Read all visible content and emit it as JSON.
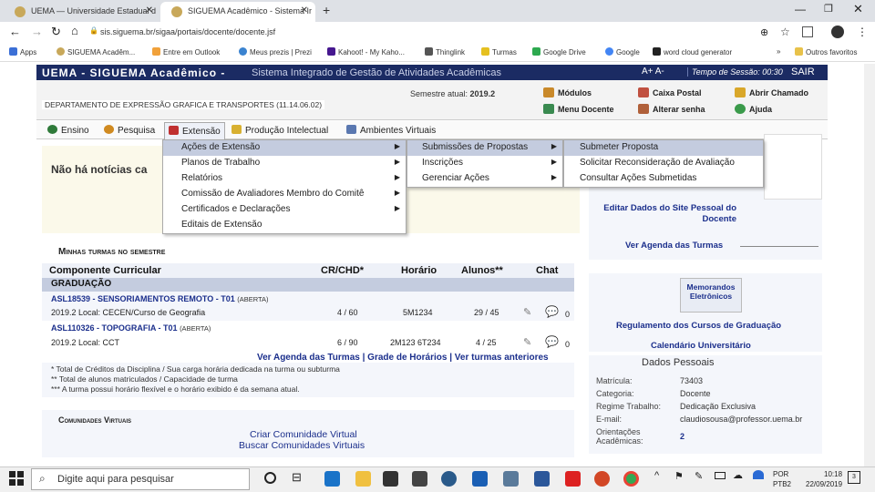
{
  "browser": {
    "tabs": [
      {
        "title": "UEMA — Universidade Estadual d"
      },
      {
        "title": "SIGUEMA Acadêmico - Sistema Ir"
      }
    ],
    "new_tab": "+",
    "address": "sis.siguema.br/sigaa/portais/docente/docente.jsf",
    "bookmarks": [
      "Apps",
      "SIGUEMA Acadêm...",
      "Entre em Outlook",
      "Meus prezis | Prezi",
      "Kahoot! - My Kaho...",
      "Thinglink",
      "Turmas",
      "Google Drive",
      "Google",
      "word cloud generator"
    ],
    "other_bookmarks": "Outros favoritos"
  },
  "header": {
    "title": "UEMA - SIGUEMA Acadêmico -",
    "subtitle": "Sistema Integrado de Gestão de Atividades Acadêmicas",
    "font_controls": "A+ A-",
    "session": "Tempo de Sessão: 00:30",
    "logout": "SAIR"
  },
  "subheader": {
    "department": "DEPARTAMENTO DE EXPRESSÃO GRAFICA E TRANSPORTES (11.14.06.02)",
    "semester_label": "Semestre atual:",
    "semester_value": "2019.2",
    "quick": [
      {
        "label": "Módulos",
        "color": "#c9892a"
      },
      {
        "label": "Caixa Postal",
        "color": "#c05040"
      },
      {
        "label": "Abrir Chamado",
        "color": "#d9a72a"
      },
      {
        "label": "Menu Docente",
        "color": "#3a8a50"
      },
      {
        "label": "Alterar senha",
        "color": "#b0603a"
      },
      {
        "label": "Ajuda",
        "color": "#3a9a4a"
      }
    ]
  },
  "menu": [
    {
      "label": "Ensino",
      "color": "#2f7a3a"
    },
    {
      "label": "Pesquisa",
      "color": "#d08a20"
    },
    {
      "label": "Extensão",
      "color": "#c03030"
    },
    {
      "label": "Produção Intelectual",
      "color": "#d8b030"
    },
    {
      "label": "Ambientes Virtuais",
      "color": "#5a78b0"
    }
  ],
  "dropdown1": [
    "Ações de Extensão",
    "Planos de Trabalho",
    "Relatórios",
    "Comissão de Avaliadores Membro do Comitê",
    "Certificados e Declarações",
    "Editais de Extensão"
  ],
  "dropdown2": [
    "Submissões de Propostas",
    "Inscrições",
    "Gerenciar Ações"
  ],
  "dropdown3": [
    "Submeter Proposta",
    "Solicitar Reconsideração de Avaliação",
    "Consultar Ações Submetidas"
  ],
  "news": "Não há notícias ca",
  "turmas": {
    "title": "Minhas turmas no semestre",
    "headers": [
      "Componente Curricular",
      "CR/CHD*",
      "Horário",
      "Alunos**",
      "Chat"
    ],
    "group": "GRADUAÇÃO",
    "rows": [
      {
        "course": "ASL18539 - SENSORIAMENTOS REMOTO - T01",
        "status": "(ABERTA)",
        "local": "2019.2 Local: CECEN/Curso de Geografia",
        "cr": "4 / 60",
        "horario": "5M1234",
        "alunos": "29 / 45",
        "chat": "0"
      },
      {
        "course": "ASL110326 - TOPOGRAFIA - T01",
        "status": "(ABERTA)",
        "local": "2019.2 Local: CCT",
        "cr": "6 / 90",
        "horario": "2M123 6T234",
        "alunos": "4 / 25",
        "chat": "0"
      }
    ],
    "links": "Ver Agenda das Turmas | Grade de Horários | Ver turmas anteriores",
    "notes": [
      "* Total de Créditos da Disciplina / Sua carga horária dedicada na turma ou subturma",
      "** Total de alunos matriculados / Capacidade de turma",
      "*** A turma possui horário flexível e o horário exibido é da semana atual."
    ]
  },
  "comunidades": {
    "title": "Comunidades Virtuais",
    "create": "Criar Comunidade Virtual",
    "search": "Buscar Comunidades Virtuais"
  },
  "right": {
    "edit_site": "Editar Dados do Site Pessoal do Docente",
    "agenda": "Ver Agenda das Turmas",
    "memo_line1": "Memorandos",
    "memo_line2": "Eletrônicos",
    "regulamento": "Regulamento dos Cursos de Graduação",
    "calendario": "Calendário Universitário",
    "pd_title": "Dados Pessoais",
    "pd": [
      {
        "label": "Matrícula:",
        "value": "73403"
      },
      {
        "label": "Categoria:",
        "value": "Docente"
      },
      {
        "label": "Regime Trabalho:",
        "value": "Dedicação Exclusiva"
      },
      {
        "label": "E-mail:",
        "value": "claudiosousa@professor.uema.br"
      },
      {
        "label": "Orientações Acadêmicas:",
        "value": "2"
      }
    ]
  },
  "taskbar": {
    "search": "Digite aqui para pesquisar",
    "lang1": "POR",
    "lang2": "PTB2",
    "time": "10:18",
    "date": "22/09/2019",
    "notif": "3"
  }
}
